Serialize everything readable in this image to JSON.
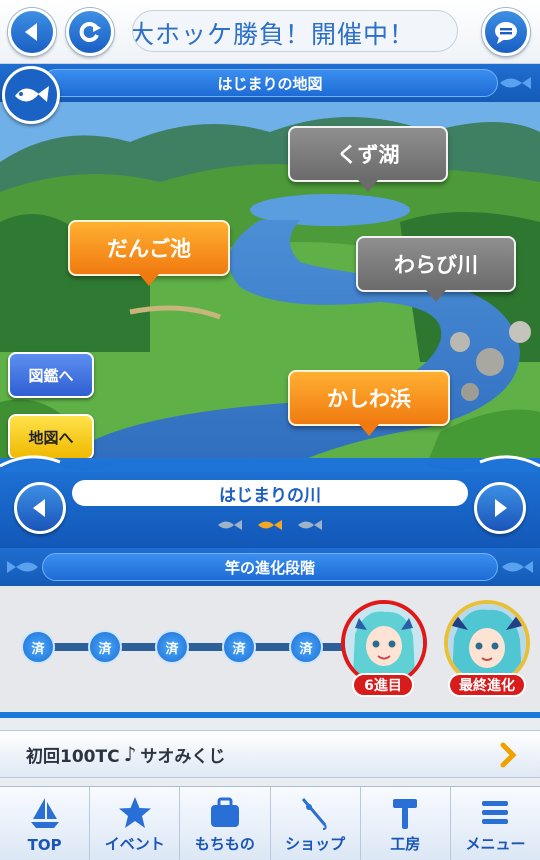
{
  "header": {
    "back_icon": "back-arrow-icon",
    "refresh_icon": "refresh-icon",
    "marquee_text": "大ホッケ勝負！開催中！",
    "chat_icon": "chat-bubble-icon"
  },
  "map_section": {
    "title": "はじまりの地図",
    "locations": [
      {
        "name": "くず湖",
        "state": "locked",
        "color": "#7a7a7a"
      },
      {
        "name": "だんご池",
        "state": "unlocked",
        "color": "#f5901c"
      },
      {
        "name": "わらび川",
        "state": "locked",
        "color": "#7a7a7a"
      },
      {
        "name": "かしわ浜",
        "state": "unlocked",
        "color": "#f5901c"
      }
    ],
    "side_buttons": {
      "encyclopedia": "図鑑へ",
      "map": "地図へ"
    },
    "current_place": "はじまりの川",
    "page_indicator": {
      "total": 3,
      "active": 2
    }
  },
  "rod_section": {
    "title": "竿の進化段階",
    "completed_stages": [
      "済",
      "済",
      "済",
      "済",
      "済"
    ],
    "current_stage_label": "6進目",
    "final_stage_label": "最終進化"
  },
  "lottery": {
    "label": "初回100TC",
    "note_icon": "music-note-icon",
    "label_suffix": "サオみくじ"
  },
  "tabbar": [
    {
      "label": "TOP",
      "icon": "sailboat-icon"
    },
    {
      "label": "イベント",
      "icon": "star-icon"
    },
    {
      "label": "もちもの",
      "icon": "bag-icon"
    },
    {
      "label": "ショップ",
      "icon": "fishing-rod-icon"
    },
    {
      "label": "工房",
      "icon": "hammer-icon"
    },
    {
      "label": "メニュー",
      "icon": "menu-icon"
    }
  ],
  "colors": {
    "primary_blue": "#1a62c3",
    "accent_orange": "#f5901c",
    "current_red": "#e01818"
  }
}
